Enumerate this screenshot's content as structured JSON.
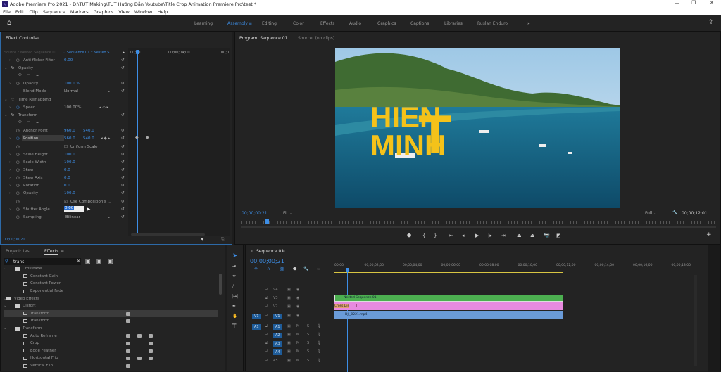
{
  "window": {
    "title": "Adobe Premiere Pro 2021 - D:\\TUT Making\\TUT Hướng Dẫn Youtube\\Title Crop Animation Premiere Pro\\test *",
    "app_icon": "Pr"
  },
  "menu": [
    "File",
    "Edit",
    "Clip",
    "Sequence",
    "Markers",
    "Graphics",
    "View",
    "Window",
    "Help"
  ],
  "workspaces": {
    "tabs": [
      "Learning",
      "Assembly",
      "Editing",
      "Color",
      "Effects",
      "Audio",
      "Graphics",
      "Captions",
      "Libraries",
      "Ruslan Enduro"
    ],
    "active": "Assembly",
    "more": "»"
  },
  "effect_controls": {
    "title": "Effect Controls",
    "source": "Source * Nested Sequence 01",
    "sequence": "Sequence 01 * Nested S...",
    "ruler": [
      "00;00",
      "00;00;04;00",
      "00;0"
    ],
    "current_time": "00;00;00;21",
    "rows": {
      "anti_flicker": {
        "label": "Anti-flicker Filter",
        "value": "0.00"
      },
      "opacity_group": "Opacity",
      "opacity": {
        "label": "Opacity",
        "value": "100.0 %"
      },
      "blend_mode": {
        "label": "Blend Mode",
        "value": "Normal"
      },
      "time_remapping": "Time Remapping",
      "speed": {
        "label": "Speed",
        "value": "100.00%"
      },
      "transform": "Transform",
      "anchor": {
        "label": "Anchor Point",
        "x": "960.0",
        "y": "540.0"
      },
      "position": {
        "label": "Position",
        "x": "560.0",
        "y": "540.0"
      },
      "uniform_scale": "Uniform Scale",
      "scale_height": {
        "label": "Scale Height",
        "value": "100.0"
      },
      "scale_width": {
        "label": "Scale Width",
        "value": "100.0"
      },
      "skew": {
        "label": "Skew",
        "value": "0.0"
      },
      "skew_axis": {
        "label": "Skew Axis",
        "value": "0.0"
      },
      "rotation": {
        "label": "Rotation",
        "value": "0.0"
      },
      "t_opacity": {
        "label": "Opacity",
        "value": "100.0"
      },
      "use_comp": "Use Composition's ...",
      "shutter": {
        "label": "Shutter Angle",
        "value": "0.00"
      },
      "sampling": {
        "label": "Sampling",
        "value": "Bilinear"
      }
    }
  },
  "program": {
    "title": "Program: Sequence 01",
    "source_tab": "Source: (no clips)",
    "overlay_text": [
      "HIEN",
      "MINH",
      "T"
    ],
    "timecode": "00;00;00;21",
    "fit": "Fit",
    "quality": "Full",
    "duration": "00;00;12;01"
  },
  "project": {
    "tab1": "Project: test",
    "tab2": "Effects",
    "search": "trans",
    "items": [
      {
        "label": "Crossfade",
        "level": 1,
        "type": "folder"
      },
      {
        "label": "Constant Gain",
        "level": 2,
        "type": "audio"
      },
      {
        "label": "Constant Power",
        "level": 2,
        "type": "audio"
      },
      {
        "label": "Exponential Fade",
        "level": 2,
        "type": "audio"
      },
      {
        "label": "Video Effects",
        "level": 0,
        "type": "folder"
      },
      {
        "label": "Distort",
        "level": 1,
        "type": "folder"
      },
      {
        "label": "Transform",
        "level": 2,
        "type": "effect",
        "badges": [
          1,
          0,
          0
        ],
        "selected": true
      },
      {
        "label": "Transform",
        "level": 2,
        "type": "effect",
        "badges": [
          1,
          0,
          0
        ]
      },
      {
        "label": "Transform",
        "level": 1,
        "type": "folder"
      },
      {
        "label": "Auto Reframe",
        "level": 2,
        "type": "effect",
        "badges": [
          1,
          1,
          1
        ]
      },
      {
        "label": "Crop",
        "level": 2,
        "type": "effect",
        "badges": [
          1,
          0,
          1
        ]
      },
      {
        "label": "Edge Feather",
        "level": 2,
        "type": "effect",
        "badges": [
          1,
          0,
          1
        ]
      },
      {
        "label": "Horizontal Flip",
        "level": 2,
        "type": "effect",
        "badges": [
          1,
          1,
          1
        ]
      },
      {
        "label": "Vertical Flip",
        "level": 2,
        "type": "effect",
        "badges": [
          1,
          0,
          0
        ]
      }
    ]
  },
  "timeline": {
    "title": "Sequence 01",
    "timecode": "00;00;00;21",
    "ruler": [
      "00;00",
      "00;00;02;00",
      "00;00;04;00",
      "00;00;06;00",
      "00;00;08;00",
      "00;00;10;00",
      "00;00;12;00",
      "00;00;14;00",
      "00;00;16;00",
      "00;00;18;00"
    ],
    "video_tracks": [
      "V4",
      "V3",
      "V2",
      "V1"
    ],
    "audio_tracks": [
      "A1",
      "A2",
      "A3",
      "A4",
      "A5"
    ],
    "source_v": "V1",
    "source_a": "A1",
    "clips": [
      {
        "label": "Nested Sequence 01",
        "color": "#4caf50"
      },
      {
        "label": "T",
        "color": "#e88ae0",
        "transition": "Cross Dis"
      },
      {
        "label": "DJI_0221.mp4",
        "color": "#6a9bd8"
      }
    ]
  }
}
